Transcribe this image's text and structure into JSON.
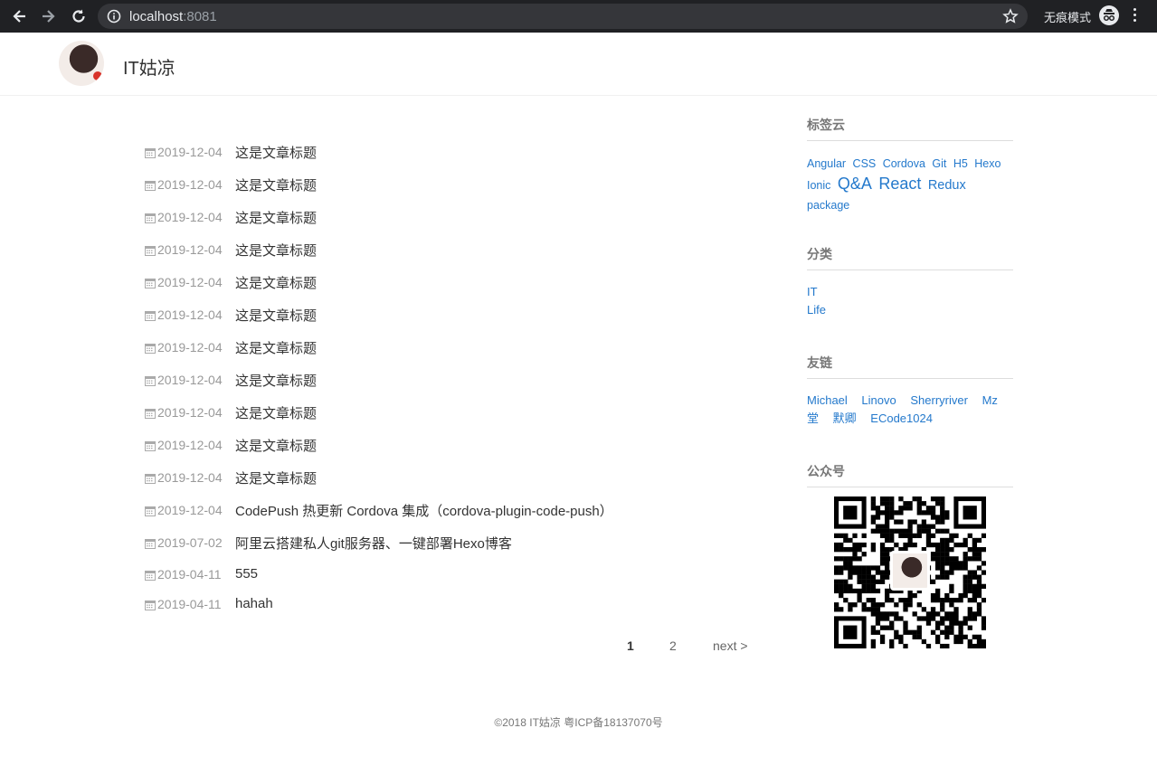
{
  "browser": {
    "url_host": "localhost",
    "url_port": ":8081",
    "incognito_label": "无痕模式"
  },
  "site": {
    "title": "IT姑凉"
  },
  "posts": [
    {
      "date": "2019-12-04",
      "title": "这是文章标题"
    },
    {
      "date": "2019-12-04",
      "title": "这是文章标题"
    },
    {
      "date": "2019-12-04",
      "title": "这是文章标题"
    },
    {
      "date": "2019-12-04",
      "title": "这是文章标题"
    },
    {
      "date": "2019-12-04",
      "title": "这是文章标题"
    },
    {
      "date": "2019-12-04",
      "title": "这是文章标题"
    },
    {
      "date": "2019-12-04",
      "title": "这是文章标题"
    },
    {
      "date": "2019-12-04",
      "title": "这是文章标题"
    },
    {
      "date": "2019-12-04",
      "title": "这是文章标题"
    },
    {
      "date": "2019-12-04",
      "title": "这是文章标题"
    },
    {
      "date": "2019-12-04",
      "title": "这是文章标题"
    },
    {
      "date": "2019-12-04",
      "title": "CodePush 热更新 Cordova 集成（cordova-plugin-code-push）"
    },
    {
      "date": "2019-07-02",
      "title": "阿里云搭建私人git服务器、一键部署Hexo博客"
    },
    {
      "date": "2019-04-11",
      "title": "555"
    },
    {
      "date": "2019-04-11",
      "title": "hahah"
    }
  ],
  "pagination": {
    "current": "1",
    "page2": "2",
    "next": "next >"
  },
  "sidebar": {
    "tags_title": "标签云",
    "tags": [
      {
        "label": "Angular",
        "size": "small"
      },
      {
        "label": "CSS",
        "size": "small"
      },
      {
        "label": "Cordova",
        "size": "small"
      },
      {
        "label": "Git",
        "size": "small"
      },
      {
        "label": "H5",
        "size": "small"
      },
      {
        "label": "Hexo",
        "size": "small"
      },
      {
        "label": "Ionic",
        "size": "small"
      },
      {
        "label": "Q&A",
        "size": "large"
      },
      {
        "label": "React",
        "size": "large"
      },
      {
        "label": "Redux",
        "size": "medium"
      },
      {
        "label": "package",
        "size": "small"
      }
    ],
    "categories_title": "分类",
    "categories": [
      "IT",
      "Life"
    ],
    "links_title": "友链",
    "links": [
      "Michael",
      "Linovo",
      "Sherryriver",
      "Mz堂",
      "默卿",
      "ECode1024"
    ],
    "wechat_title": "公众号"
  },
  "footer": {
    "text": "©2018 IT姑凉   粤ICP备18137070号"
  },
  "colors": {
    "link": "#2479cc",
    "chrome_bg": "#202124"
  }
}
